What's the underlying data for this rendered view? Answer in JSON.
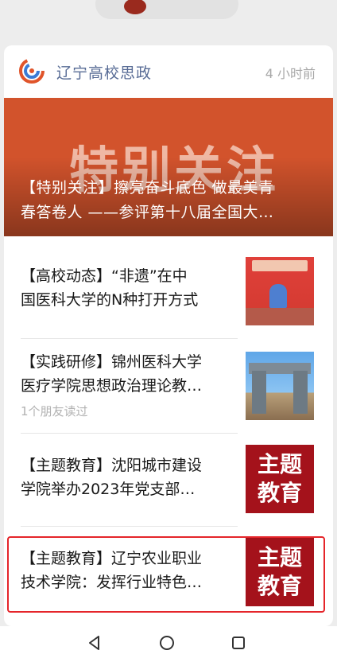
{
  "account": {
    "name": "辽宁高校思政",
    "time_ago": "4 小时前"
  },
  "hero": {
    "background_text": "特别关注",
    "title_lines": [
      "【特别关注】擦亮奋斗底色 做最美青",
      "春答卷人 ——参评第十八届全国大…"
    ]
  },
  "articles": [
    {
      "title_lines": [
        "【高校动态】“非遗”在中",
        "国医科大学的N种打开方式"
      ],
      "meta": "",
      "thumb": "red-stage-image"
    },
    {
      "title_lines": [
        "【实践研修】锦州医科大学",
        "医疗学院思想政治理论教…"
      ],
      "meta": "1个朋友读过",
      "thumb": "gate-image"
    },
    {
      "title_lines": [
        "【主题教育】沈阳城市建设",
        "学院举办2023年党支部…"
      ],
      "meta": "",
      "thumb_text": [
        "主题",
        "教育"
      ]
    },
    {
      "title_lines": [
        "【主题教育】辽宁农业职业",
        "技术学院：发挥行业特色…"
      ],
      "meta": "",
      "thumb_text": [
        "主题",
        "教育"
      ]
    }
  ],
  "colors": {
    "account_name": "#576b95",
    "hero_bg": "#d2532c",
    "theme_thumb": "#a4121b",
    "highlight": "#e5252a"
  },
  "nav_icons": [
    "back-triangle-icon",
    "home-circle-icon",
    "recents-square-icon"
  ]
}
